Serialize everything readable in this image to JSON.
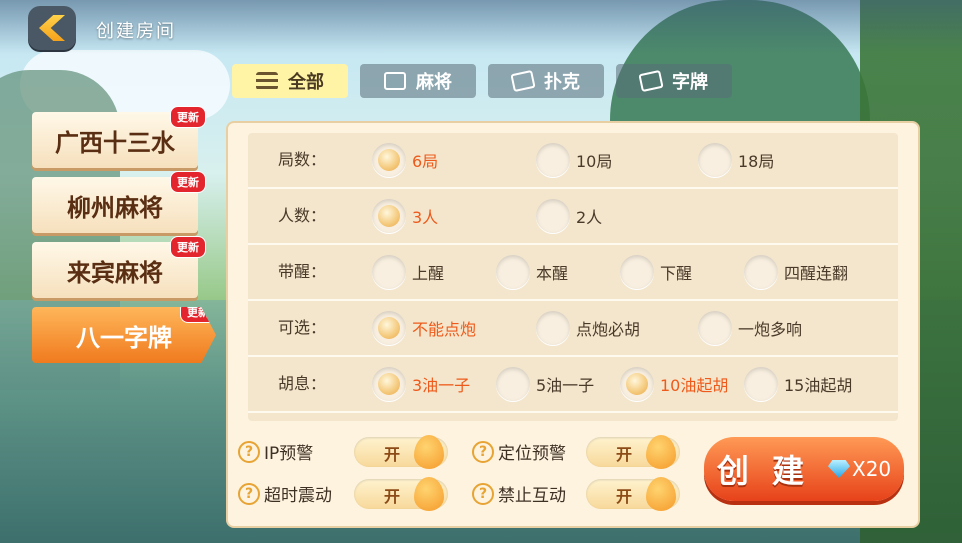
{
  "header": {
    "title": "创建房间"
  },
  "tabs": [
    {
      "label": "全部",
      "icon": "list-icon",
      "active": true
    },
    {
      "label": "麻将",
      "icon": "mahjong-icon",
      "active": false
    },
    {
      "label": "扑克",
      "icon": "poker-icon",
      "active": false
    },
    {
      "label": "字牌",
      "icon": "zipai-icon",
      "active": false
    }
  ],
  "games": [
    {
      "label": "广西十三水",
      "badge": "更新",
      "active": false
    },
    {
      "label": "柳州麻将",
      "badge": "更新",
      "active": false
    },
    {
      "label": "来宾麻将",
      "badge": "更新",
      "active": false
    },
    {
      "label": "八一字牌",
      "badge": "更新",
      "active": true
    }
  ],
  "options": [
    {
      "label": "局数：",
      "choices": [
        {
          "text": "6局",
          "selected": true
        },
        {
          "text": "10局",
          "selected": false
        },
        {
          "text": "18局",
          "selected": false
        }
      ]
    },
    {
      "label": "人数：",
      "choices": [
        {
          "text": "3人",
          "selected": true
        },
        {
          "text": "2人",
          "selected": false
        }
      ]
    },
    {
      "label": "带醒：",
      "choices": [
        {
          "text": "上醒",
          "selected": false
        },
        {
          "text": "本醒",
          "selected": false
        },
        {
          "text": "下醒",
          "selected": false
        },
        {
          "text": "四醒连翻",
          "selected": false
        }
      ]
    },
    {
      "label": "可选：",
      "choices": [
        {
          "text": "不能点炮",
          "selected": true
        },
        {
          "text": "点炮必胡",
          "selected": false
        },
        {
          "text": "一炮多响",
          "selected": false
        }
      ]
    },
    {
      "label": "胡息：",
      "choices": [
        {
          "text": "3油一子",
          "selected": true
        },
        {
          "text": "5油一子",
          "selected": false
        },
        {
          "text": "10油起胡",
          "selected": true
        },
        {
          "text": "15油起胡",
          "selected": false
        }
      ]
    }
  ],
  "toggles": [
    {
      "label": "IP预警",
      "state": "开"
    },
    {
      "label": "定位预警",
      "state": "开"
    },
    {
      "label": "超时震动",
      "state": "开"
    },
    {
      "label": "禁止互动",
      "state": "开"
    }
  ],
  "create": {
    "label": "创 建",
    "cost": "X20",
    "cost_icon": "diamond-icon"
  },
  "colors": {
    "accent": "#ee5a1b",
    "active_tab": "#fff4a6",
    "create_button": "#e7421a"
  }
}
